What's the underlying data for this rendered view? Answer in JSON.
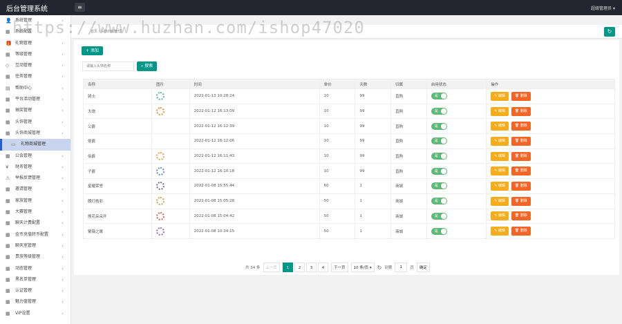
{
  "app": {
    "title": "后台管理系统",
    "user": "超级管理员"
  },
  "watermark": "https://www.huzhan.com/ishop47020",
  "sidebar": {
    "items": [
      {
        "label": "系统管理",
        "icon": "user-icon",
        "arrow": "‹"
      },
      {
        "label": "系统配置",
        "icon": "grid-icon",
        "arrow": ""
      },
      {
        "label": "礼物管理",
        "icon": "gift-icon",
        "arrow": "‹"
      },
      {
        "label": "等级管理",
        "icon": "grid-icon",
        "arrow": "‹"
      },
      {
        "label": "互动管理",
        "icon": "diamond-icon",
        "arrow": "‹"
      },
      {
        "label": "任务管理",
        "icon": "grid-icon",
        "arrow": "‹"
      },
      {
        "label": "帮助中心",
        "icon": "calendar-icon",
        "arrow": "‹"
      },
      {
        "label": "平台活动管理",
        "icon": "grid-icon",
        "arrow": "‹"
      },
      {
        "label": "抽奖管理",
        "icon": "grid-icon",
        "arrow": "‹"
      },
      {
        "label": "头饰管理",
        "icon": "grid-icon",
        "arrow": "‹"
      },
      {
        "label": "头饰商城管理",
        "icon": "grid-icon",
        "arrow": "‹"
      },
      {
        "label": "礼物商城管理",
        "icon": "file-icon",
        "arrow": "",
        "active": true
      },
      {
        "label": "公会管理",
        "icon": "grid-icon",
        "arrow": "‹"
      },
      {
        "label": "财务管理",
        "icon": "money-icon",
        "arrow": "‹"
      },
      {
        "label": "举报反馈管理",
        "icon": "alert-icon",
        "arrow": "‹"
      },
      {
        "label": "邀请管理",
        "icon": "grid-icon",
        "arrow": "‹"
      },
      {
        "label": "家族管理",
        "icon": "grid-icon",
        "arrow": "‹"
      },
      {
        "label": "大赛管理",
        "icon": "grid-icon",
        "arrow": "‹"
      },
      {
        "label": "聊天计费配置",
        "icon": "grid-icon",
        "arrow": "‹"
      },
      {
        "label": "金币充值转币配置",
        "icon": "grid-icon",
        "arrow": "‹"
      },
      {
        "label": "聊天室管理",
        "icon": "grid-icon",
        "arrow": "‹"
      },
      {
        "label": "贵族等级管理",
        "icon": "grid-icon",
        "arrow": "‹"
      },
      {
        "label": "动态管理",
        "icon": "grid-icon",
        "arrow": "‹"
      },
      {
        "label": "黑名单管理",
        "icon": "grid-icon",
        "arrow": "‹"
      },
      {
        "label": "认证管理",
        "icon": "grid-icon",
        "arrow": "‹"
      },
      {
        "label": "魅力值管理",
        "icon": "grid-icon",
        "arrow": "‹"
      },
      {
        "label": "VIP设置",
        "icon": "grid-icon",
        "arrow": "‹"
      }
    ]
  },
  "breadcrumb": "首页 / 头饰商城管理",
  "toolbar": {
    "add_label": "+ 添加",
    "search_label": "搜索",
    "search_placeholder": "请输入头饰名称"
  },
  "table": {
    "headers": [
      "名称",
      "图片",
      "时间",
      "单价",
      "天数",
      "归属",
      "启用状态",
      "操作"
    ],
    "rows": [
      {
        "name": "骑士",
        "img": true,
        "ring": "#5bb0a8",
        "time": "2022-01-13 10:28:24",
        "price": "10",
        "days": "99",
        "belong": "直购"
      },
      {
        "name": "大炮",
        "img": true,
        "ring": "#e8903a",
        "time": "2022-01-12 16:13:09",
        "price": "10",
        "days": "99",
        "belong": "直购"
      },
      {
        "name": "公爵",
        "img": false,
        "ring": "",
        "time": "2022-01-12 16:12:39",
        "price": "10",
        "days": "99",
        "belong": "直购"
      },
      {
        "name": "侯爵",
        "img": false,
        "ring": "",
        "time": "2022-01-12 16:12:06",
        "price": "10",
        "days": "99",
        "belong": "直购"
      },
      {
        "name": "伯爵",
        "img": true,
        "ring": "#e8a24a",
        "time": "2022-01-12 16:11:43",
        "price": "10",
        "days": "99",
        "belong": "直购"
      },
      {
        "name": "子爵",
        "img": true,
        "ring": "#5a8fd6",
        "time": "2022-01-12 16:10:18",
        "price": "10",
        "days": "99",
        "belong": "直购"
      },
      {
        "name": "星耀荣誉",
        "img": true,
        "ring": "#6d6d8a",
        "time": "2022-01-08 15:55:44",
        "price": "60",
        "days": "1",
        "belong": "商城"
      },
      {
        "name": "朗灯皓彩",
        "img": true,
        "ring": "#c9a24a",
        "time": "2022-01-08 15:05:28",
        "price": "50",
        "days": "1",
        "belong": "商城"
      },
      {
        "name": "挽花朵朵开",
        "img": true,
        "ring": "#d66a4a",
        "time": "2022-01-08 15:04:42",
        "price": "50",
        "days": "1",
        "belong": "商城"
      },
      {
        "name": "紫薇之翼",
        "img": true,
        "ring": "#9a6ab0",
        "time": "2022-01-08 10:34:15",
        "price": "50",
        "days": "1",
        "belong": "商城"
      }
    ],
    "switch_label": "是",
    "edit_label": "✎ 编辑",
    "delete_label": "🗑 删除"
  },
  "pager": {
    "total": "共 34 条",
    "prev": "上一页",
    "pages": [
      "1",
      "2",
      "3",
      "4"
    ],
    "current": "1",
    "next": "下一页",
    "per_page": "10 条/页",
    "goto_label": "到第",
    "goto_value": "1",
    "page_unit": "页",
    "confirm": "确定"
  }
}
